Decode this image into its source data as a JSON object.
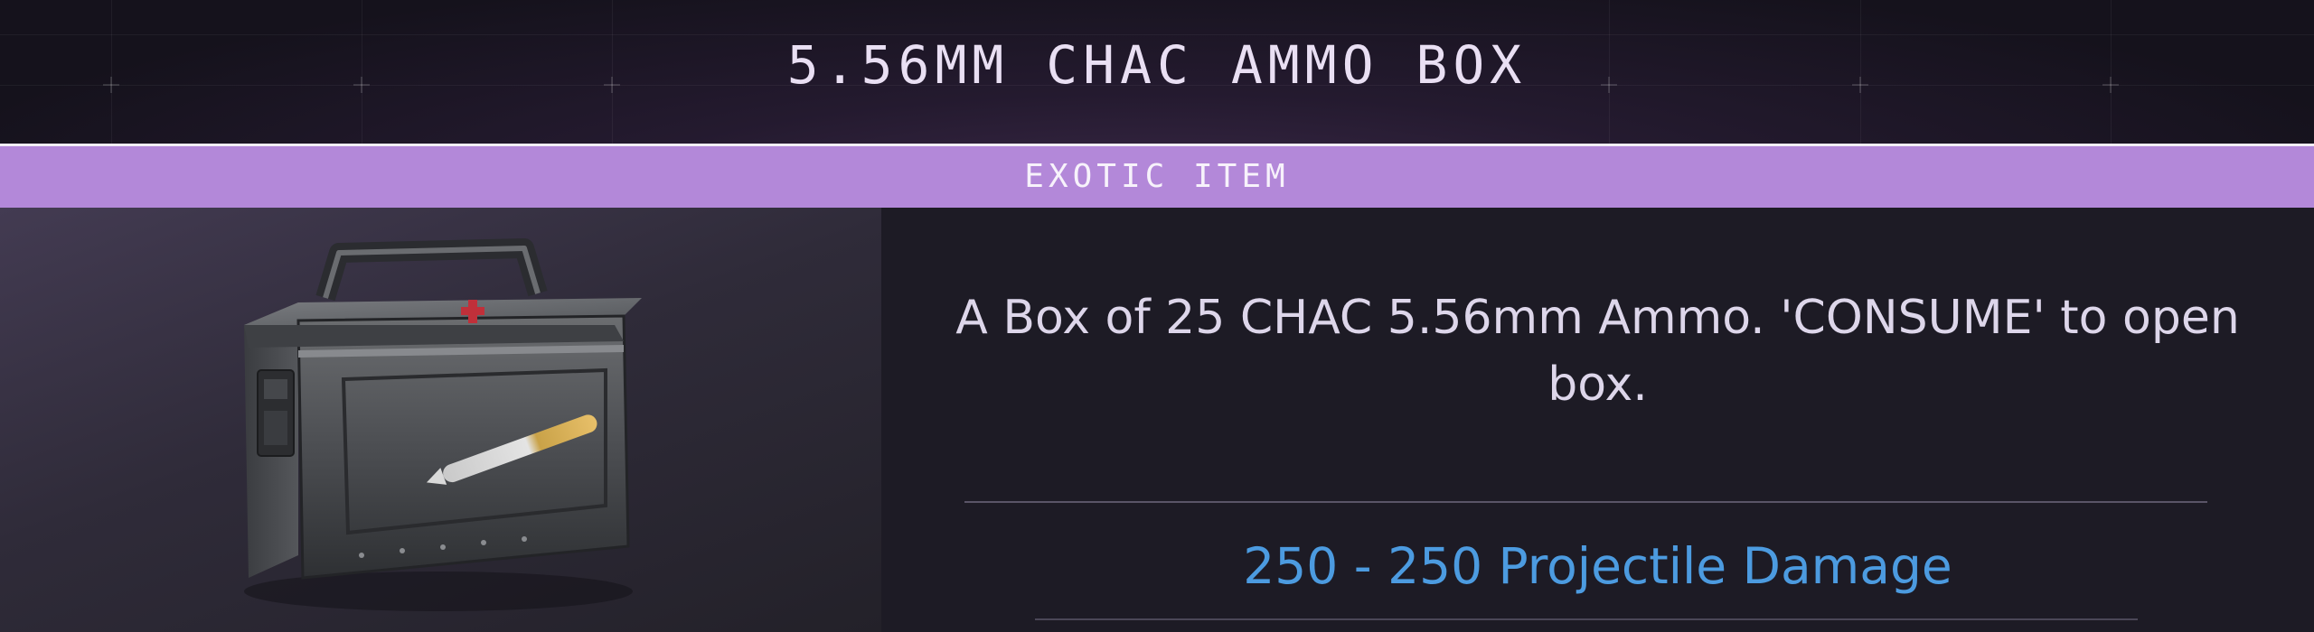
{
  "item": {
    "title": "5.56MM CHAC AMMO BOX",
    "rarity": "EXOTIC ITEM",
    "rarity_color": "#b388d9",
    "image_icon": "ammo-box-icon",
    "description": "A Box of 25 CHAC 5.56mm Ammo. 'CONSUME' to open box.",
    "stats": [
      {
        "text": "250 - 250 Projectile Damage",
        "color": "#4c9be0"
      }
    ]
  }
}
